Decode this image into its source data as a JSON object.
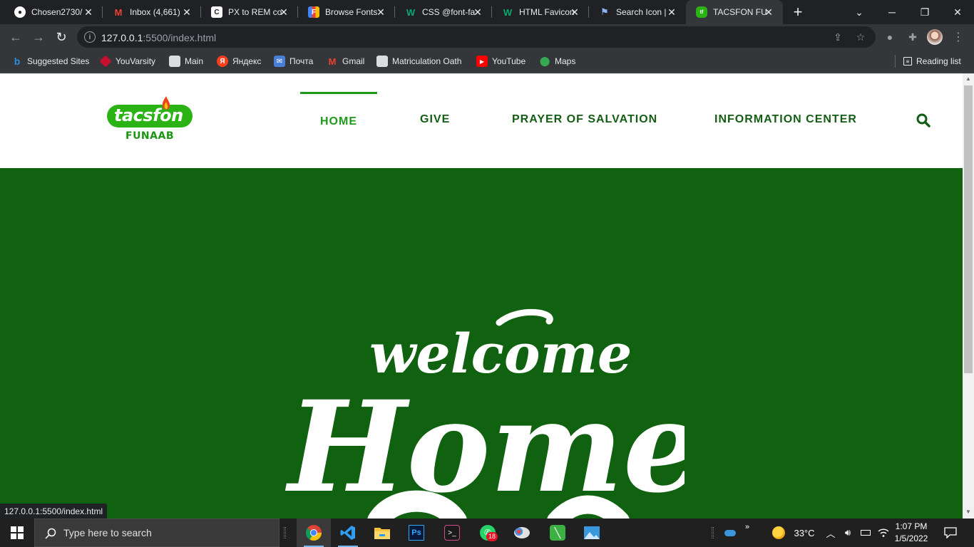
{
  "browser": {
    "tabs": [
      {
        "title": "Chosen2730/",
        "icon": "github-icon"
      },
      {
        "title": "Inbox (4,661)",
        "icon": "gmail-icon"
      },
      {
        "title": "PX to REM co",
        "icon": "c-icon"
      },
      {
        "title": "Browse Fonts",
        "icon": "google-fonts-icon"
      },
      {
        "title": "CSS @font-fa",
        "icon": "w3schools-icon"
      },
      {
        "title": "HTML Favicon",
        "icon": "w3schools-icon"
      },
      {
        "title": "Search Icon |",
        "icon": "flag-icon"
      },
      {
        "title": "TACSFON FU",
        "icon": "tacsfon-icon",
        "active": true
      }
    ],
    "url_host": "127.0.0.1",
    "url_path": ":5500/index.html",
    "bookmarks": [
      {
        "label": "Suggested Sites",
        "icon": "bing-icon"
      },
      {
        "label": "YouVarsity",
        "icon": "youvarsity-icon"
      },
      {
        "label": "Main",
        "icon": "page-icon"
      },
      {
        "label": "Яндекс",
        "icon": "yandex-icon"
      },
      {
        "label": "Почта",
        "icon": "mail-icon"
      },
      {
        "label": "Gmail",
        "icon": "gmail-icon"
      },
      {
        "label": "Matriculation Oath",
        "icon": "page-icon"
      },
      {
        "label": "YouTube",
        "icon": "youtube-icon"
      },
      {
        "label": "Maps",
        "icon": "maps-icon"
      }
    ],
    "reading_list": "Reading list",
    "status_url": "127.0.0.1:5500/index.html"
  },
  "site": {
    "logo_text": "tacsfon",
    "logo_sub": "FUNAAB",
    "nav": [
      {
        "label": "HOME",
        "active": true
      },
      {
        "label": "GIVE"
      },
      {
        "label": "PRAYER OF SALVATION"
      },
      {
        "label": "INFORMATION CENTER"
      }
    ],
    "hero_line1": "welcome",
    "hero_line2": "Home",
    "colors": {
      "brand_green": "#106110",
      "nav_green": "#145d14",
      "active_green": "#1e9a1a",
      "logo_green": "#2bb316"
    }
  },
  "taskbar": {
    "search_placeholder": "Type here to search",
    "whatsapp_badge": "18",
    "temperature": "33°C",
    "time": "1:07 PM",
    "date": "1/5/2022",
    "apps": [
      "chrome-icon",
      "vscode-icon",
      "file-explorer-icon",
      "photoshop-icon",
      "terminal-icon",
      "whatsapp-icon",
      "paint-icon",
      "notepad-icon",
      "photos-icon"
    ]
  }
}
